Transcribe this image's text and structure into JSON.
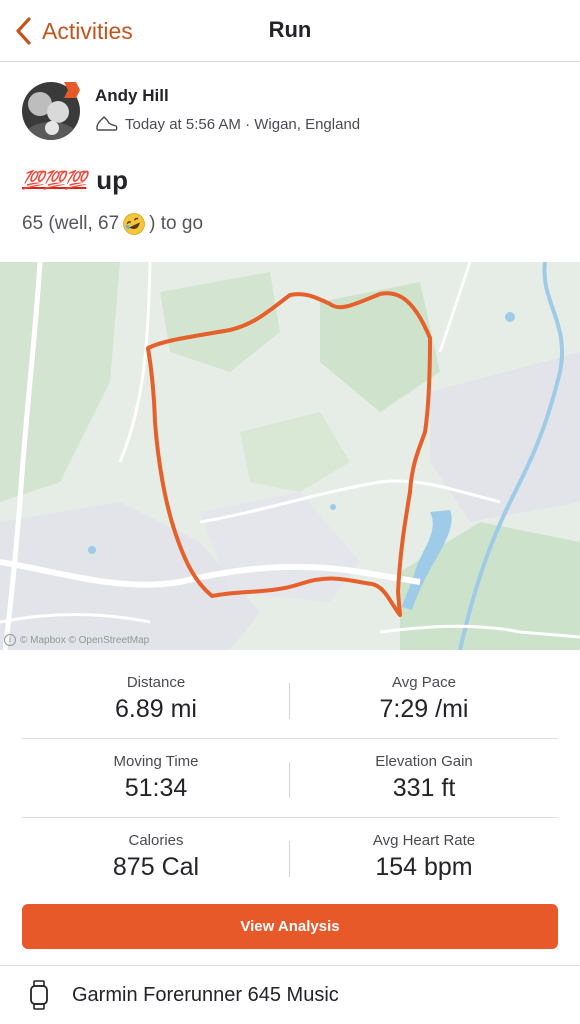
{
  "nav": {
    "back_label": "Activities",
    "title": "Run",
    "accent_color": "#c4541d"
  },
  "athlete": {
    "name": "Andy Hill",
    "meta": "Today at 5:56 AM · Wigan, England",
    "activity_icon": "shoe-icon"
  },
  "activity": {
    "title_emoji": "💯💯💯",
    "title_word": "up",
    "desc_before": "65 (well, 67",
    "desc_after": ") to go"
  },
  "map": {
    "attribution": "© Mapbox © OpenStreetMap",
    "route_color": "#e5602b"
  },
  "stats": [
    {
      "label": "Distance",
      "value": "6.89 mi"
    },
    {
      "label": "Avg Pace",
      "value": "7:29 /mi"
    },
    {
      "label": "Moving Time",
      "value": "51:34"
    },
    {
      "label": "Elevation Gain",
      "value": "331 ft"
    },
    {
      "label": "Calories",
      "value": "875 Cal"
    },
    {
      "label": "Avg Heart Rate",
      "value": "154 bpm"
    }
  ],
  "cta": {
    "label": "View Analysis",
    "color": "#e8592a"
  },
  "device": {
    "name": "Garmin Forerunner 645 Music",
    "icon": "watch-icon"
  }
}
